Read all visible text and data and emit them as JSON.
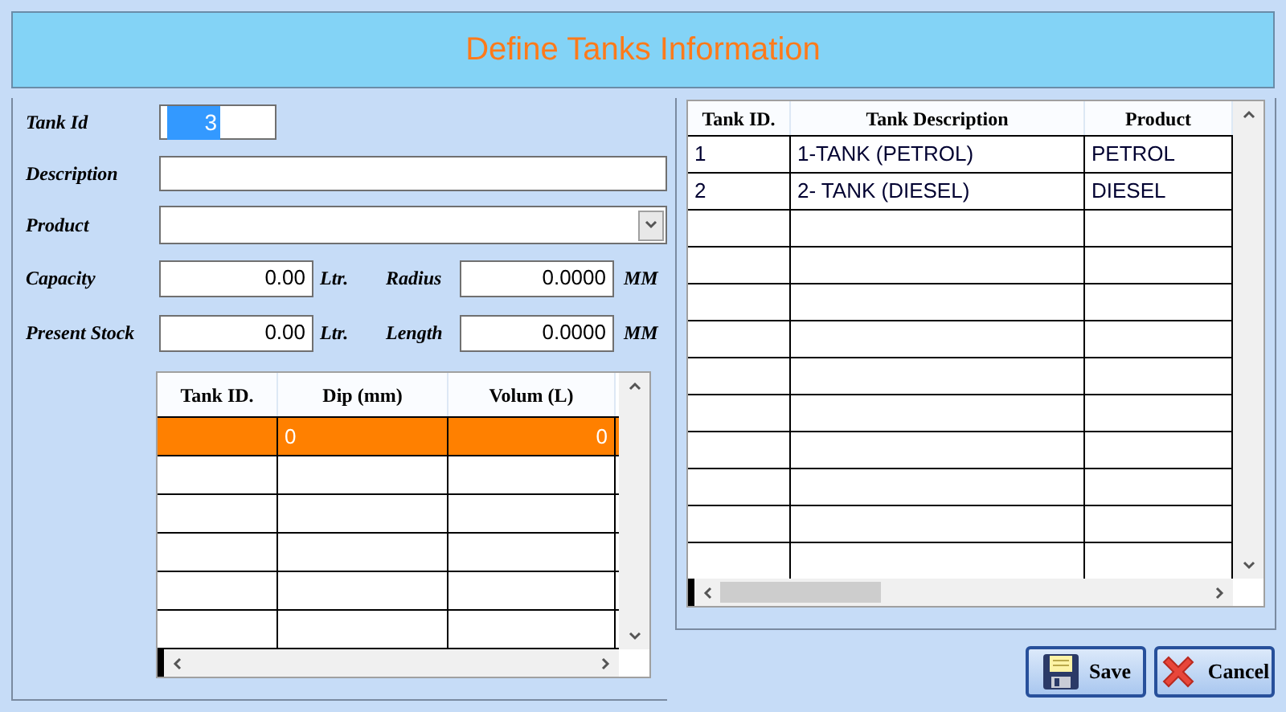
{
  "window": {
    "title": "Define Tanks Information"
  },
  "form": {
    "fields": [
      {
        "kind": "text",
        "label": "Tank Id",
        "value": "3",
        "selected": true
      },
      {
        "kind": "text",
        "label": "Description"
      },
      {
        "kind": "dropdown",
        "label": "Product"
      }
    ],
    "measures": [
      {
        "label": "Capacity",
        "value": "0.00",
        "unit": "Ltr.",
        "label2": "Radius",
        "value2": "0.0000",
        "unit2": "MM"
      },
      {
        "label": "Present Stock",
        "value": "0.00",
        "unit": "Ltr.",
        "label2": "Length",
        "value2": "0.0000",
        "unit2": "MM"
      }
    ]
  },
  "dip_table": {
    "columns": [
      "Tank ID.",
      "Dip (mm)",
      "Volum (L)"
    ],
    "rows": [
      {
        "cells": [
          "",
          "0",
          "0"
        ],
        "selected": true
      }
    ]
  },
  "tanks_table": {
    "columns": [
      "Tank ID.",
      "Tank Description",
      "Product"
    ],
    "rows": [
      {
        "cells": [
          "1",
          "1-TANK (PETROL)",
          "PETROL"
        ],
        "selected": false
      },
      {
        "cells": [
          "2",
          "2- TANK (DIESEL)",
          "DIESEL"
        ],
        "selected": false
      }
    ]
  },
  "buttons": [
    {
      "kind": "save",
      "label": "Save"
    },
    {
      "kind": "cancel",
      "label": "Cancel"
    }
  ]
}
